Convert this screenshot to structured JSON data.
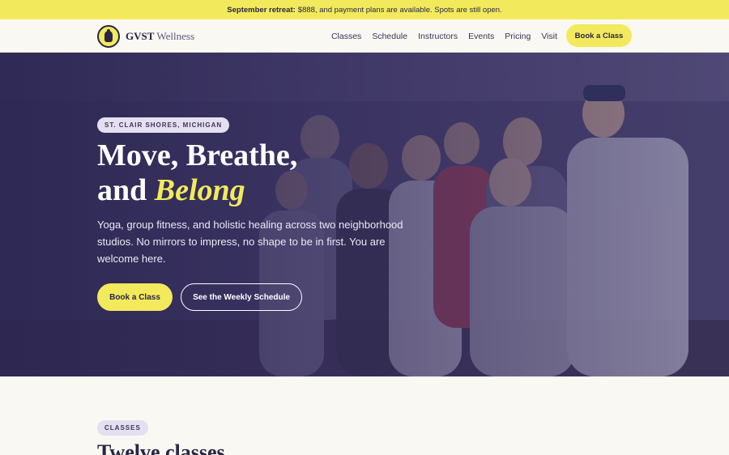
{
  "announcement": {
    "bold": "September retreat:",
    "text": "$888, and payment plans are available. Spots are still open."
  },
  "nav": {
    "brand": "GVST",
    "brand_sub": "Wellness",
    "items": [
      {
        "label": "Classes"
      },
      {
        "label": "Schedule"
      },
      {
        "label": "Instructors"
      },
      {
        "label": "Events"
      },
      {
        "label": "Pricing"
      },
      {
        "label": "Visit"
      }
    ],
    "cta": "Book a Class"
  },
  "hero": {
    "eyebrow": "ST. CLAIR SHORES, MICHIGAN",
    "title_line1": "Move, Breathe,",
    "title_line2_plain": "and ",
    "title_line2_accent": "Belong",
    "lede": "Yoga, group fitness, and holistic healing across two neighborhood studios. No mirrors to impress, no shape to be in first. You are welcome here.",
    "primary_cta": "Book a Class",
    "secondary_cta": "See the Weekly Schedule"
  },
  "classes_section": {
    "badge": "CLASSES",
    "title": "Twelve classes"
  },
  "colors": {
    "accent": "#f2ea5c",
    "ink": "#2a2545",
    "hero_tint": "#3b3560",
    "background": "#faf8f3"
  }
}
